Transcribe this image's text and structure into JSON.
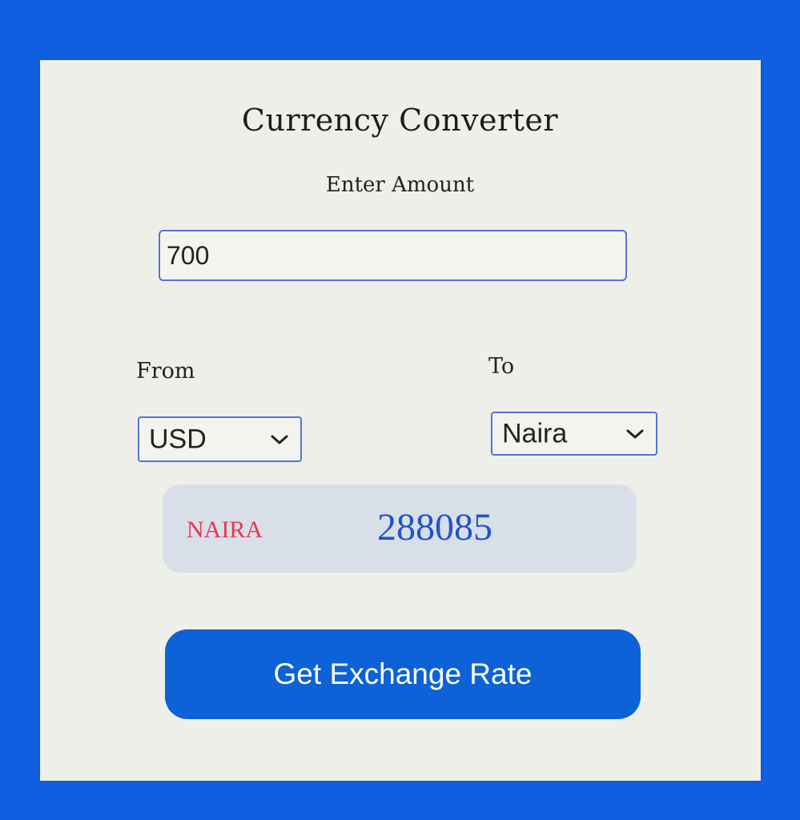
{
  "converter": {
    "title": "Currency Converter",
    "amount_label": "Enter Amount",
    "amount_value": "700",
    "from_label": "From",
    "to_label": "To",
    "from_selected": "USD",
    "to_selected": "Naira",
    "result_currency": "NAIRA",
    "result_value": "288085",
    "button_label": "Get Exchange Rate"
  },
  "colors": {
    "background": "#0f5fe0",
    "card": "#efefe9",
    "accent": "#0c62d6",
    "result_currency": "#e8374d",
    "result_value": "#1f55c9"
  },
  "icons": {
    "dropdown": "chevron-down-icon"
  }
}
